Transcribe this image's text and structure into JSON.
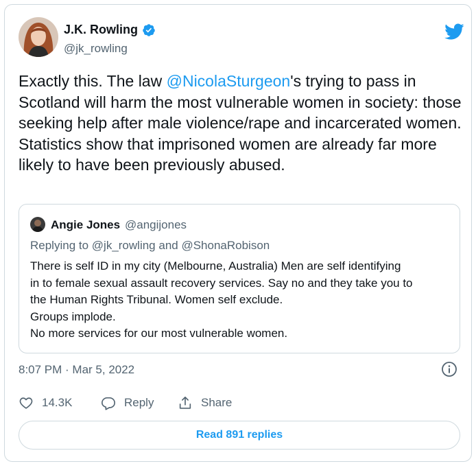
{
  "author": {
    "name": "J.K. Rowling",
    "handle": "@jk_rowling",
    "verified_icon": "verified-badge-icon",
    "avatar_icon": "avatar"
  },
  "brand": {
    "icon": "twitter-bird-icon",
    "color": "#1d9bf0"
  },
  "tweet": {
    "text_before": "Exactly this. The law ",
    "mention": "@NicolaSturgeon",
    "text_after": "'s trying to pass in Scotland will harm the most vulnerable women in society: those seeking help after male violence/rape and incarcerated women. Statistics show that imprisoned women are already far more likely to have been previously abused."
  },
  "quote": {
    "name": "Angie Jones",
    "handle": "@angijones",
    "replying_prefix": "Replying to ",
    "replying_mention1": "@jk_rowling",
    "replying_and": " and ",
    "replying_mention2": "@ShonaRobison",
    "lines": [
      "There is self ID in my city (Melbourne, Australia) Men are self identifying",
      "in to female sexual assault recovery services. Say no and they take you to",
      "the Human Rights Tribunal. Women self exclude.",
      "Groups implode.",
      "No more services for our most vulnerable women."
    ]
  },
  "timestamp": "8:07 PM · Mar 5, 2022",
  "actions": {
    "like_count": "14.3K",
    "reply_label": "Reply",
    "share_label": "Share"
  },
  "read_replies_label": "Read 891 replies",
  "colors": {
    "text": "#0f1419",
    "secondary": "#536471",
    "border": "#cfd9de",
    "accent": "#1d9bf0"
  }
}
